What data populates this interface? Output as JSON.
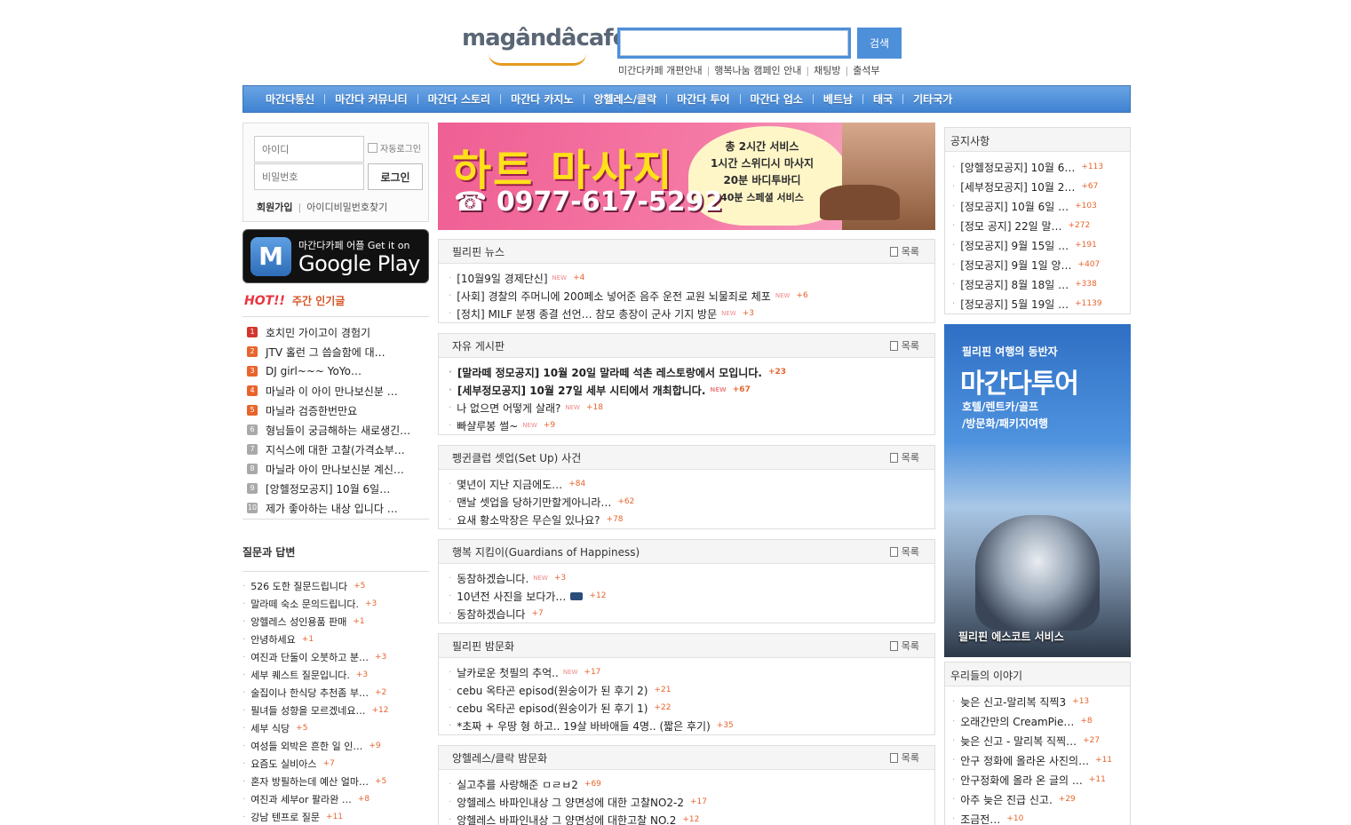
{
  "header": {
    "logo_text": "magândâcafe",
    "search_placeholder": "",
    "search_button": "검색",
    "top_links": [
      "미간다카페 개편안내",
      "행복나눔 캠페인 안내",
      "채팅방",
      "출석부"
    ]
  },
  "nav": [
    "마간다통신",
    "마간다 커뮤니티",
    "마간다 스토리",
    "마간다 카지노",
    "앙헬레스/클락",
    "마간다 투어",
    "마간다 업소",
    "베트남",
    "태국",
    "기타국가"
  ],
  "login": {
    "id_placeholder": "아이디",
    "pw_placeholder": "비밀번호",
    "auto_login": "자동로그인",
    "login_button": "로그인",
    "join": "회원가입",
    "find": "아이디비밀번호찾기"
  },
  "gplay": {
    "small": "마간다카페 어플   Get it on",
    "large": "Google Play",
    "icon": "M"
  },
  "hot": {
    "badge": "HOT!!",
    "title": "주간 인기글",
    "items": [
      {
        "rank": "1",
        "title": "호치민 가이고이 경험기",
        "color": "#d2372f"
      },
      {
        "rank": "2",
        "title": "JTV 홀런 그 씁슬함에 대…",
        "color": "#e8642c"
      },
      {
        "rank": "3",
        "title": "DJ girl~~~ YoYo…",
        "color": "#e8642c"
      },
      {
        "rank": "4",
        "title": "마닐라 이 아이 만나보신분 …",
        "color": "#e8642c"
      },
      {
        "rank": "5",
        "title": "마닐라 검증한번만요",
        "color": "#e8642c"
      },
      {
        "rank": "6",
        "title": "형님들이 궁금해하는 새로생긴…",
        "color": "#a9a9a9"
      },
      {
        "rank": "7",
        "title": "지식스에 대한 고찰(가격쇼부…",
        "color": "#a9a9a9"
      },
      {
        "rank": "8",
        "title": "마닐라 아이 만나보신분 계신…",
        "color": "#a9a9a9"
      },
      {
        "rank": "9",
        "title": "[앙헬정모공지] 10월 6일…",
        "color": "#a9a9a9"
      },
      {
        "rank": "10",
        "title": "제가 좋아하는 내상 입니다 …",
        "color": "#a9a9a9"
      }
    ]
  },
  "qa": {
    "title": "질문과 답변",
    "items": [
      {
        "title": "526 도한 질문드립니다",
        "count": "+5"
      },
      {
        "title": "말라떼 숙소 문의드립니다.",
        "count": "+3"
      },
      {
        "title": "앙헬레스 성인용품 판매",
        "count": "+1"
      },
      {
        "title": "안녕하세요",
        "count": "+1"
      },
      {
        "title": "여진과 단둘이 오붓하고 분…",
        "count": "+3"
      },
      {
        "title": "세부 퀘스트 질문입니다.",
        "count": "+3"
      },
      {
        "title": "술집이나 한식당 추천좀 부…",
        "count": "+2"
      },
      {
        "title": "필녀들 성향을 모르겠네요…",
        "count": "+12"
      },
      {
        "title": "세부 식당",
        "count": "+5"
      },
      {
        "title": "여성들 외박은 흔한 일 인…",
        "count": "+9"
      },
      {
        "title": "요즘도 실비아스",
        "count": "+7"
      },
      {
        "title": "혼자 방필하는데 예산 얼마…",
        "count": "+5"
      },
      {
        "title": "여진과 세부or 팔라완 …",
        "count": "+8"
      },
      {
        "title": "강남 텐프로 질문",
        "count": "+11"
      }
    ]
  },
  "banner": {
    "title": "하트 마사지",
    "phone": "☎ 0977-617-5292",
    "services": [
      "총 2시간 서비스",
      "1시간 스위디시 마사지",
      "20분 바디투바디",
      "40분 스페셜 서비스"
    ]
  },
  "more_label": "목록",
  "new_label": "NEW",
  "boards": [
    {
      "title": "필리핀 뉴스",
      "items": [
        {
          "title": "[10월9일 경제단신]",
          "new": true,
          "count": "+4",
          "bold": false
        },
        {
          "title": "[사회] 경찰의 주머니에 200페소 넣어준 음주 운전 교원 뇌물죄로 체포",
          "new": true,
          "count": "+6",
          "bold": false
        },
        {
          "title": "[정치] MILF 분쟁 종결 선언… 참모 총장이 군사 기지 방문",
          "new": true,
          "count": "+3",
          "bold": false
        }
      ]
    },
    {
      "title": "자유 게시판",
      "items": [
        {
          "title": "[말라떼 정모공지] 10월 20일 말라떼 석촌 레스토랑에서 모입니다.",
          "new": false,
          "count": "+23",
          "bold": true
        },
        {
          "title": "[세부정모공지] 10월 27일 세부 시티에서 개최합니다.",
          "new": true,
          "count": "+67",
          "bold": true
        },
        {
          "title": "나 없으면 어떻게 살래?",
          "new": true,
          "count": "+18",
          "bold": false
        },
        {
          "title": "빠샬루봉 썰~",
          "new": true,
          "count": "+9",
          "bold": false
        }
      ]
    },
    {
      "title": "펭귄클럽 셋업(Set Up) 사건",
      "items": [
        {
          "title": "몇년이 지난 지금에도…",
          "new": false,
          "count": "+84",
          "bold": false
        },
        {
          "title": "맨날 셋업을 당하기만할게아니라…",
          "new": false,
          "count": "+62",
          "bold": false
        },
        {
          "title": "요새 황소막장은 무슨일 있나요?",
          "new": false,
          "count": "+78",
          "bold": false
        }
      ]
    },
    {
      "title": "행복 지킴이(Guardians of Happiness)",
      "items": [
        {
          "title": "동참하겠습니다.",
          "new": true,
          "count": "+3",
          "bold": false
        },
        {
          "title": "10년전 사진을 보다가…",
          "new": false,
          "camera": true,
          "count": "+12",
          "bold": false
        },
        {
          "title": "동참하겠습니다",
          "new": false,
          "count": "+7",
          "bold": false
        }
      ]
    },
    {
      "title": "필리핀 밤문화",
      "items": [
        {
          "title": "날카로운 첫필의 추억..",
          "new": true,
          "count": "+17",
          "bold": false
        },
        {
          "title": "cebu 옥타곤 episod(원숭이가 된 후기 2)",
          "new": false,
          "count": "+21",
          "bold": false
        },
        {
          "title": "cebu 옥타곤 episod(원숭이가 된 후기 1)",
          "new": false,
          "count": "+22",
          "bold": false
        },
        {
          "title": "*초짜 + 우땅 형 하고.. 19살 바바애들 4명.. (짧은 후기)",
          "new": false,
          "count": "+35",
          "bold": false
        }
      ]
    },
    {
      "title": "앙헬레스/클락 밤문화",
      "items": [
        {
          "title": "실고추를 사랑해준 ㅁㄹㅂ2",
          "new": false,
          "count": "+69",
          "bold": false
        },
        {
          "title": "앙헬레스 바파인내상 그 양면성에 대한 고찰NO2-2",
          "new": false,
          "count": "+17",
          "bold": false
        },
        {
          "title": "앙헬레스 바파인내상 그 양면성에 대한고찰 NO.2",
          "new": false,
          "count": "+12",
          "bold": false
        }
      ]
    }
  ],
  "notice": {
    "title": "공지사항",
    "items": [
      {
        "title": "[앙헬정모공지] 10월 6…",
        "count": "+113"
      },
      {
        "title": "[세부정모공지] 10월 2…",
        "count": "+67"
      },
      {
        "title": "[정모공지] 10월 6일 …",
        "count": "+103"
      },
      {
        "title": "[정모 공지] 22일 말…",
        "count": "+272"
      },
      {
        "title": "[정모공지] 9월 15일 …",
        "count": "+191"
      },
      {
        "title": "[정모공지] 9월 1일 앙…",
        "count": "+407"
      },
      {
        "title": "[정모공지] 8월 18일 …",
        "count": "+338"
      },
      {
        "title": "[정모공지] 5월 19일 …",
        "count": "+1139"
      }
    ]
  },
  "tour_ad": {
    "sub": "필리핀 여행의 동반자",
    "title": "마간다투어",
    "desc1": "호텔/렌트카/골프",
    "desc2": "/방문화/패키지여행",
    "bottom": "필리핀 에스코트 서비스"
  },
  "stories": {
    "title": "우리들의 이야기",
    "items": [
      {
        "title": "늦은 신고-말리복 직찍3",
        "count": "+13"
      },
      {
        "title": "오래간만의 CreamPie…",
        "count": "+8"
      },
      {
        "title": "늦은 신고 - 말리복 직찍…",
        "count": "+27"
      },
      {
        "title": "안구 정화에 올라온 사진의…",
        "count": "+11"
      },
      {
        "title": "안구정화에 올라 온 글의 …",
        "count": "+11"
      },
      {
        "title": "아주 늦은 진급 신고.",
        "count": "+29"
      },
      {
        "title": "조금전…",
        "count": "+10"
      }
    ]
  }
}
